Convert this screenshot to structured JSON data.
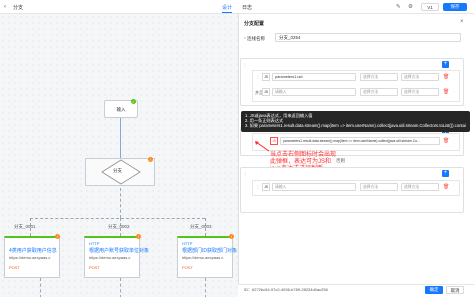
{
  "header": {
    "title": "分支",
    "tabs": [
      {
        "label": "设计"
      },
      {
        "label": "日志"
      }
    ],
    "version": "V1",
    "save_label": "保存"
  },
  "canvas": {
    "start_node": {
      "label": "输入"
    },
    "branch_node": {
      "label": "分支"
    },
    "edge_labels": [
      "分支_0001",
      "分支_0002",
      "分支_0003"
    ],
    "http_nodes": [
      {
        "kind": "HTTP",
        "title": "4类用户获取用户信息",
        "url": "https://demo.aexpaas.c",
        "method": "POST",
        "method_label": "POST"
      },
      {
        "kind": "HTTP",
        "title": "根据用户账号获取单位对象",
        "url": "https://demo.aexpaas.c",
        "method": "POST",
        "method_label": "POST"
      },
      {
        "kind": "HTTP",
        "title": "根据部门ID获取部门对象",
        "url": "https://demo.aexpaas.c",
        "method": "POST",
        "method_label": "POST"
      }
    ]
  },
  "drawer": {
    "title": "分支配置",
    "name_label": "连线名称",
    "name_value": "分支_0254",
    "card1": {
      "row1": {
        "type": "JS",
        "field": "parameters1.uid",
        "operator": "选择方法",
        "value": "选择方法"
      },
      "andor": "并且",
      "row2": {
        "type": "JS",
        "field": "请输入",
        "operator": "选择方法",
        "value": "选择方法"
      }
    },
    "tooltip_lines": [
      "1. JS或java表达式，用来返回输入值",
      "2. 用一条正则表达式",
      "3. 如果 parameters1.result.data.stream().map(item => item.userName).collect(java.util.stream.Collectors.toList()).contains(\"your name\")"
    ],
    "card2": {
      "row1": {
        "type": "JS",
        "field": "parameters1.result.data.stream().map(item => item.userName).collect(java.util.stream.Co...",
        "operator": "",
        "value": ""
      }
    },
    "else_label": "否则",
    "card3": {
      "row1": {
        "type": "JS",
        "field": "请输入",
        "operator": "选择方法",
        "value": "选择方法"
      }
    },
    "annotation": "当点击右侧图标时会出现此弹框，表达可为JS和java表达式进行判断",
    "footer": {
      "id_text": "ID：6272bc54-97c2-4936-b789-28234d0ac256",
      "confirm": "确定",
      "cancel": "取消"
    }
  }
}
